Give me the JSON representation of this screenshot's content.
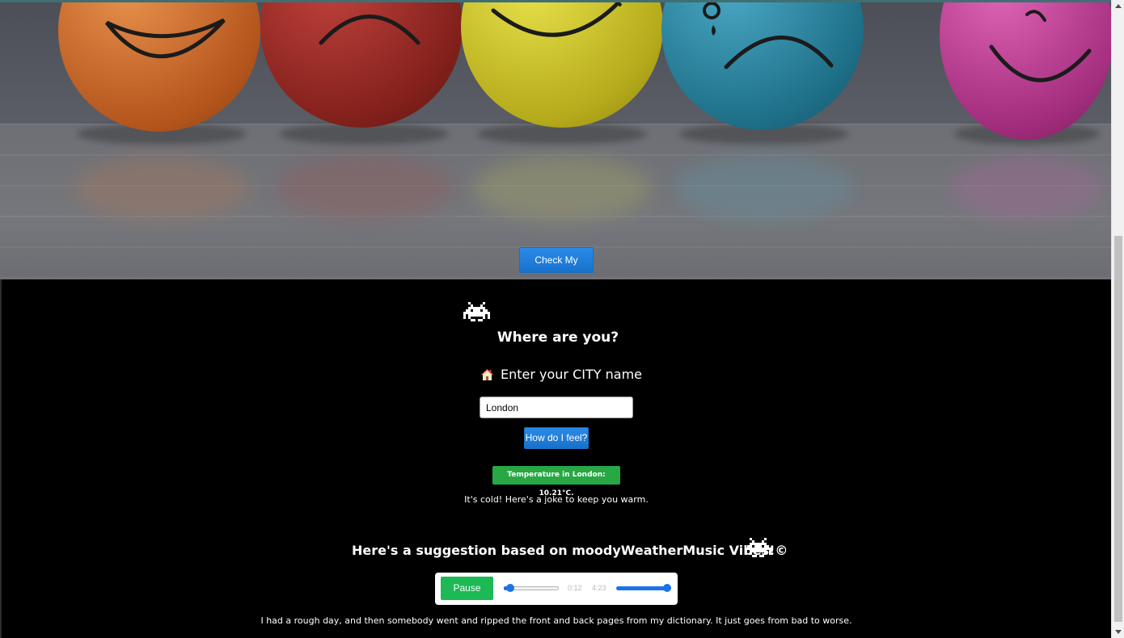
{
  "hero": {
    "mood_button_label": "Check My Mood!"
  },
  "main": {
    "where_title": "Where are you?",
    "city_label": "Enter your CITY name",
    "city_input_value": "London",
    "feel_button_label": "How do I feel?",
    "temperature_text": "Temperature in London: 10.21°C.",
    "joke_intro": "It's cold! Here's a joke to keep you warm.",
    "suggestion_title": "Here's a suggestion based on moodyWeatherMusic Vibes!©",
    "joke_text": "I had a rough day, and then somebody went and ripped the front and back pages from my dictionary. It just goes from bad to worse."
  },
  "player": {
    "pause_label": "Pause",
    "current_time": "0:12",
    "duration": "4:23",
    "progress_fraction": 0.05,
    "volume_fraction": 1.0
  },
  "colors": {
    "accent_blue": "#1a73e8",
    "badge_green": "#28a745",
    "pause_green": "#1db954",
    "button_blue": "#2a8ae8"
  },
  "icons": [
    "space-invader-icon",
    "house-icon"
  ]
}
